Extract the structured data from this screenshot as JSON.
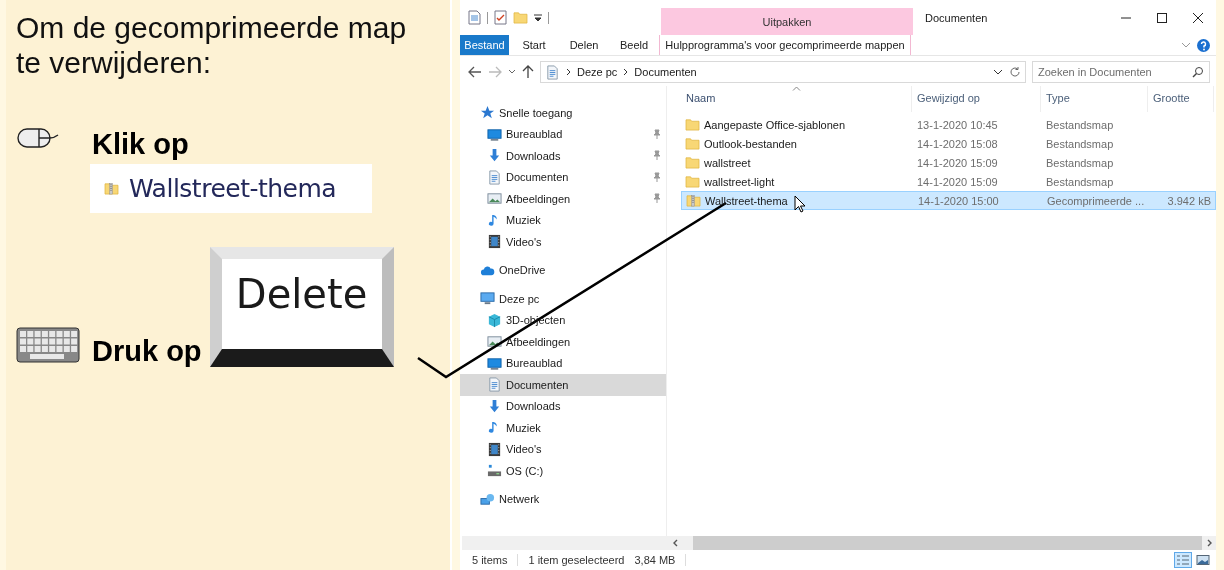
{
  "instructions": {
    "heading": "Om de gecomprimeerde map te verwijderen:",
    "steps": [
      {
        "kind": "mouse",
        "label": "Klik op",
        "target": "Wallstreet-thema"
      },
      {
        "kind": "keyboard",
        "label": "Druk op",
        "key": "Delete"
      }
    ]
  },
  "explorer": {
    "contextual_group": "Uitpakken",
    "title": "Documenten",
    "ribbon_tabs": [
      {
        "label": "Bestand",
        "kind": "file",
        "selected": false
      },
      {
        "label": "Start",
        "kind": "tab",
        "selected": false
      },
      {
        "label": "Delen",
        "kind": "tab",
        "selected": false
      },
      {
        "label": "Beeld",
        "kind": "tab",
        "selected": false
      },
      {
        "label": "Hulpprogramma's voor gecomprimeerde mappen",
        "kind": "contextual",
        "selected": false
      }
    ],
    "breadcrumb": [
      "Deze pc",
      "Documenten"
    ],
    "search": {
      "placeholder": "Zoeken in Documenten"
    },
    "navigation": [
      {
        "label": "Snelle toegang",
        "kind": "star",
        "selected": false,
        "children": [
          {
            "label": "Bureaublad",
            "kind": "desktop",
            "pinned": true,
            "selected": false
          },
          {
            "label": "Downloads",
            "kind": "download",
            "pinned": true,
            "selected": false
          },
          {
            "label": "Documenten",
            "kind": "document",
            "pinned": true,
            "selected": false
          },
          {
            "label": "Afbeeldingen",
            "kind": "pictures",
            "pinned": true,
            "selected": false
          },
          {
            "label": "Muziek",
            "kind": "music",
            "pinned": false,
            "selected": false
          },
          {
            "label": "Video's",
            "kind": "video",
            "pinned": false,
            "selected": false
          }
        ]
      },
      {
        "label": "OneDrive",
        "kind": "cloud",
        "selected": false
      },
      {
        "label": "Deze pc",
        "kind": "pc",
        "selected": false,
        "children": [
          {
            "label": "3D-objecten",
            "kind": "cube",
            "selected": false
          },
          {
            "label": "Afbeeldingen",
            "kind": "pictures",
            "selected": false
          },
          {
            "label": "Bureaublad",
            "kind": "desktop",
            "selected": false
          },
          {
            "label": "Documenten",
            "kind": "document",
            "selected": true
          },
          {
            "label": "Downloads",
            "kind": "download",
            "selected": false
          },
          {
            "label": "Muziek",
            "kind": "music",
            "selected": false
          },
          {
            "label": "Video's",
            "kind": "video",
            "selected": false
          },
          {
            "label": "OS (C:)",
            "kind": "drive",
            "selected": false
          }
        ]
      },
      {
        "label": "Netwerk",
        "kind": "network",
        "selected": false
      }
    ],
    "columns": [
      {
        "label": "Naam",
        "sorted": true
      },
      {
        "label": "Gewijzigd op",
        "sorted": false
      },
      {
        "label": "Type",
        "sorted": false
      },
      {
        "label": "Grootte",
        "sorted": false
      }
    ],
    "files": [
      {
        "name": "Aangepaste Office-sjablonen",
        "modified": "13-1-2020 10:45",
        "type": "Bestandsmap",
        "kind": "folder",
        "selected": false
      },
      {
        "name": "Outlook-bestanden",
        "modified": "14-1-2020 15:08",
        "type": "Bestandsmap",
        "kind": "folder",
        "selected": false
      },
      {
        "name": "wallstreet",
        "modified": "14-1-2020 15:09",
        "type": "Bestandsmap",
        "kind": "folder",
        "selected": false
      },
      {
        "name": "wallstreet-light",
        "modified": "14-1-2020 15:09",
        "type": "Bestandsmap",
        "kind": "folder",
        "selected": false
      },
      {
        "name": "Wallstreet-thema",
        "modified": "14-1-2020 15:00",
        "type": "Gecomprimeerde ...",
        "size": "3.942 kB",
        "kind": "zip",
        "selected": true
      }
    ],
    "status": {
      "count": "5 items",
      "selection": "1 item geselecteerd",
      "size": "3,84 MB"
    },
    "view_modes": [
      {
        "kind": "details",
        "selected": true
      },
      {
        "kind": "large_icons",
        "selected": false
      }
    ]
  }
}
